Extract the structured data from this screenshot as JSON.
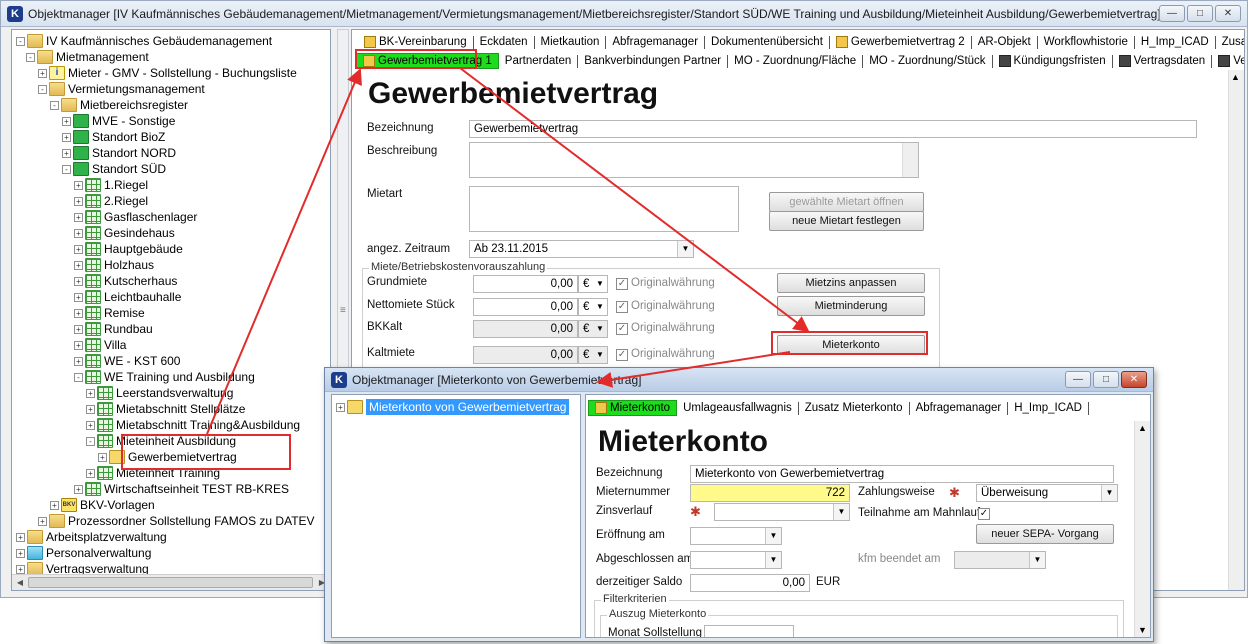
{
  "main_window": {
    "title": "Objektmanager [IV Kaufmännisches Gebäudemanagement/Mietmanagement/Vermietungsmanagement/Mietbereichsregister/Standort SÜD/WE Training und Ausbildung/Mieteinheit Ausbildung/Gewerbemietvertrag]",
    "app_icon": "K"
  },
  "tree": {
    "items": [
      {
        "label": "IV Kaufmännisches Gebäudemanagement",
        "icon": "folder"
      },
      {
        "label": "Mietmanagement",
        "icon": "folder"
      },
      {
        "label": "Mieter - GMV - Sollstellung - Buchungsliste",
        "icon": "info"
      },
      {
        "label": "Vermietungsmanagement",
        "icon": "folder"
      },
      {
        "label": "Mietbereichsregister",
        "icon": "folder"
      },
      {
        "label": "MVE - Sonstige",
        "icon": "green"
      },
      {
        "label": "Standort BioZ",
        "icon": "green"
      },
      {
        "label": "Standort NORD",
        "icon": "green"
      },
      {
        "label": "Standort SÜD",
        "icon": "green"
      },
      {
        "label": "1.Riegel",
        "icon": "grid"
      },
      {
        "label": "2.Riegel",
        "icon": "grid"
      },
      {
        "label": "Gasflaschenlager",
        "icon": "grid"
      },
      {
        "label": "Gesindehaus",
        "icon": "grid"
      },
      {
        "label": "Hauptgebäude",
        "icon": "grid"
      },
      {
        "label": "Holzhaus",
        "icon": "grid"
      },
      {
        "label": "Kutscherhaus",
        "icon": "grid"
      },
      {
        "label": "Leichtbauhalle",
        "icon": "grid"
      },
      {
        "label": "Remise",
        "icon": "grid"
      },
      {
        "label": "Rundbau",
        "icon": "grid"
      },
      {
        "label": "Villa",
        "icon": "grid"
      },
      {
        "label": "WE - KST 600",
        "icon": "grid"
      },
      {
        "label": "WE Training und Ausbildung",
        "icon": "grid"
      },
      {
        "label": "Leerstandsverwaltung",
        "icon": "grid"
      },
      {
        "label": "Mietabschnitt Stellplätze",
        "icon": "grid"
      },
      {
        "label": "Mietabschnitt Training&Ausbildung",
        "icon": "grid"
      },
      {
        "label": "Mieteinheit Ausbildung",
        "icon": "grid"
      },
      {
        "label": "Gewerbemietvertrag",
        "icon": "doc"
      },
      {
        "label": "Mieteinheit Training",
        "icon": "grid"
      },
      {
        "label": "Wirtschaftseinheit TEST RB-KRES",
        "icon": "grid"
      },
      {
        "label": "BKV-Vorlagen",
        "icon": "bkv"
      },
      {
        "label": "Prozessordner Sollstellung FAMOS zu DATEV",
        "icon": "folder"
      },
      {
        "label": "Arbeitsplatzverwaltung",
        "icon": "folder"
      },
      {
        "label": "Personalverwaltung",
        "icon": "folder-blue"
      },
      {
        "label": "Vertragsverwaltung",
        "icon": "folder"
      }
    ]
  },
  "tabs_row1": [
    "BK-Vereinbarung",
    "Eckdaten",
    "Mietkaution",
    "Abfragemanager",
    "Dokumentenübersicht",
    "Gewerbemietvertrag 2",
    "AR-Objekt",
    "Workflowhistorie",
    "H_Imp_ICAD",
    "Zusatz GMV"
  ],
  "tabs_row2": [
    "Gewerbemietvertrag 1",
    "Partnerdaten",
    "Bankverbindungen Partner",
    "MO - Zuordnung/Fläche",
    "MO - Zuordnung/Stück",
    "Kündigungsfristen",
    "Vertragsdaten",
    "Vertragsklauseln"
  ],
  "form": {
    "title": "Gewerbemietvertrag",
    "bezeichnung_label": "Bezeichnung",
    "bezeichnung_value": "Gewerbemietvertrag",
    "beschreibung_label": "Beschreibung",
    "mietart_label": "Mietart",
    "btn_open_mietart": "gewählte Mietart öffnen",
    "btn_new_mietart": "neue Mietart festlegen",
    "zeitraum_label": "angez. Zeitraum",
    "zeitraum_value": "Ab 23.11.2015",
    "group_title": "Miete/Betriebskostenvorauszahlung",
    "rows": [
      {
        "label": "Grundmiete",
        "value": "0,00",
        "currency": "€",
        "check": "Originalwährung"
      },
      {
        "label": "Nettomiete Stück",
        "value": "0,00",
        "currency": "€",
        "check": "Originalwährung"
      },
      {
        "label": "BKKalt",
        "value": "0,00",
        "currency": "€",
        "check": "Originalwährung"
      },
      {
        "label": "Kaltmiete",
        "value": "0,00",
        "currency": "€",
        "check": "Originalwährung"
      }
    ],
    "btn_mietzins": "Mietzins anpassen",
    "btn_mietminderung": "Mietminderung",
    "btn_mieterkonto": "Mieterkonto"
  },
  "win2": {
    "title": "Objektmanager [Mieterkonto von Gewerbemietvertrag]",
    "tree_node": "Mieterkonto von Gewerbemietvertrag",
    "tabs": [
      "Mieterkonto",
      "Umlageausfallwagnis",
      "Zusatz Mieterkonto",
      "Abfragemanager",
      "H_Imp_ICAD"
    ],
    "form_title": "Mieterkonto",
    "bezeichnung_label": "Bezeichnung",
    "bezeichnung_value": "Mieterkonto von Gewerbemietvertrag",
    "mieternummer_label": "Mieternummer",
    "mieternummer_value": "722",
    "zahlungsweise_label": "Zahlungsweise",
    "zahlungsweise_value": "Überweisung",
    "zinsverlauf_label": "Zinsverlauf",
    "mahnlauf_label": "Teilnahme am Mahnlauf",
    "eroeffnung_label": "Eröffnung am",
    "btn_sepa": "neuer SEPA- Vorgang",
    "abgeschlossen_label": "Abgeschlossen am",
    "kfm_label": "kfm beendet am",
    "saldo_label": "derzeitiger Saldo",
    "saldo_value": "0,00",
    "saldo_currency": "EUR",
    "filter_title": "Filterkriterien",
    "auszug_title": "Auszug Mieterkonto",
    "monat_label": "Monat Sollstellung"
  },
  "colors": {
    "accent_green": "#1ddc1d",
    "highlight_red": "#e22b2b",
    "selection_blue": "#3399ff",
    "yellow_field": "#fffa8a"
  }
}
